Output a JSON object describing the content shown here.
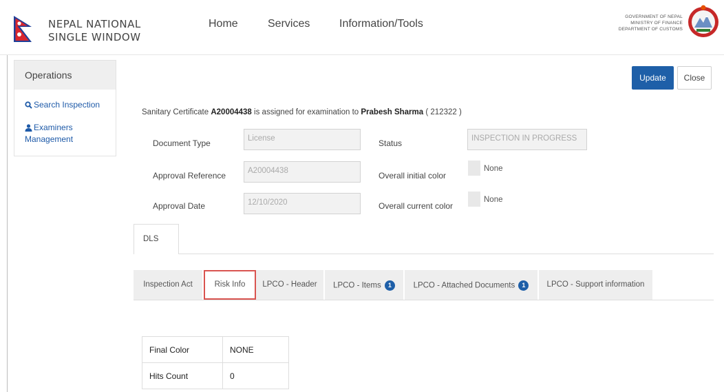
{
  "header": {
    "brand_line1": "NEPAL NATIONAL",
    "brand_line2": "SINGLE WINDOW",
    "nav": [
      "Home",
      "Services",
      "Information/Tools"
    ],
    "gov_line1": "GOVERNMENT OF NEPAL",
    "gov_line2": "MINISTRY OF FINANCE",
    "gov_line3": "DEPARTMENT OF CUSTOMS"
  },
  "sidebar": {
    "title": "Operations",
    "items": [
      {
        "label": "Search Inspection",
        "icon": "search-icon"
      },
      {
        "label_line1": "Examiners",
        "label_line2": "Management",
        "icon": "user-icon"
      }
    ]
  },
  "toolbar": {
    "update_label": "Update",
    "close_label": "Close"
  },
  "assignment": {
    "prefix": "Sanitary Certificate",
    "certificate_no": "A20004438",
    "middle": "is assigned for examination to",
    "examiner": "Prabesh Sharma",
    "examiner_id": "( 212322 )"
  },
  "form": {
    "document_type_label": "Document Type",
    "document_type_value": "License",
    "approval_reference_label": "Approval Reference",
    "approval_reference_value": "A20004438",
    "approval_date_label": "Approval Date",
    "approval_date_value": "12/10/2020",
    "status_label": "Status",
    "status_value": "INSPECTION IN PROGRESS",
    "initial_color_label": "Overall initial color",
    "initial_color_value": "None",
    "current_color_label": "Overall current color",
    "current_color_value": "None"
  },
  "tabs_top": [
    "DLS"
  ],
  "tabs": [
    {
      "label": "Inspection Act"
    },
    {
      "label": "Risk Info",
      "active": true
    },
    {
      "label": "LPCO - Header"
    },
    {
      "label": "LPCO - Items",
      "badge": "1"
    },
    {
      "label": "LPCO - Attached Documents",
      "badge": "1"
    },
    {
      "label": "LPCO - Support information"
    }
  ],
  "risk_table": {
    "rows": [
      {
        "key": "Final Color",
        "value": "NONE"
      },
      {
        "key": "Hits Count",
        "value": "0"
      }
    ]
  },
  "colors": {
    "primary": "#1e5fa8",
    "active_tab_border": "#d9534f",
    "link": "#1e5aa8"
  }
}
